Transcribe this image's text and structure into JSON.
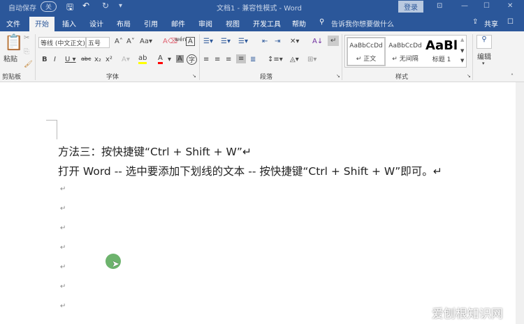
{
  "titlebar": {
    "autosave": "自动保存",
    "autosave_state": "关",
    "title": "文档1 - 兼容性模式 - Word",
    "login": "登录"
  },
  "tabs": [
    "文件",
    "开始",
    "插入",
    "设计",
    "布局",
    "引用",
    "邮件",
    "审阅",
    "视图",
    "开发工具",
    "帮助"
  ],
  "search_placeholder": "告诉我你想要做什么",
  "share": "共享",
  "ribbon": {
    "paste": "粘贴",
    "clipboard": "剪贴板",
    "font_name": "等线 (中文正文)",
    "font_size": "五号",
    "font_group": "字体",
    "paragraph_group": "段落",
    "styles": [
      {
        "preview": "AaBbCcDd",
        "name": "正文"
      },
      {
        "preview": "AaBbCcDd",
        "name": "无间隔"
      },
      {
        "preview": "AaBl",
        "name": "标题 1"
      }
    ],
    "styles_group": "样式",
    "edit": "编辑"
  },
  "document": {
    "lines": [
      "方法三：按快捷键“Ctrl + Shift + W”↵",
      "打开 Word -- 选中要添加下划线的文本 -- 按快捷键“Ctrl + Shift + W”即可。↵"
    ],
    "empty_mark": "↵"
  },
  "watermark": "爱刨根知识网",
  "colors": {
    "accent": "#2b579a",
    "highlight": "#ffff00",
    "font_color": "#ff0000"
  }
}
